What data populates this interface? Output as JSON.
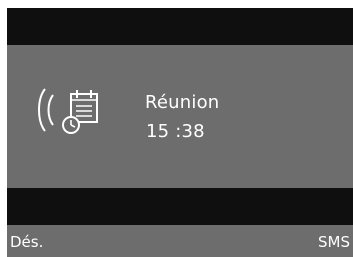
{
  "notification": {
    "title": "Réunion",
    "time": "15 :38"
  },
  "icons": {
    "signal": "ringing-waves-icon",
    "calendar": "calendar-clock-icon"
  },
  "softkeys": {
    "left_label": "Dés.",
    "right_label": "SMS"
  },
  "colors": {
    "display_gray": "#6d6d6d",
    "display_black": "#0f0f0f",
    "text": "#ffffff"
  }
}
